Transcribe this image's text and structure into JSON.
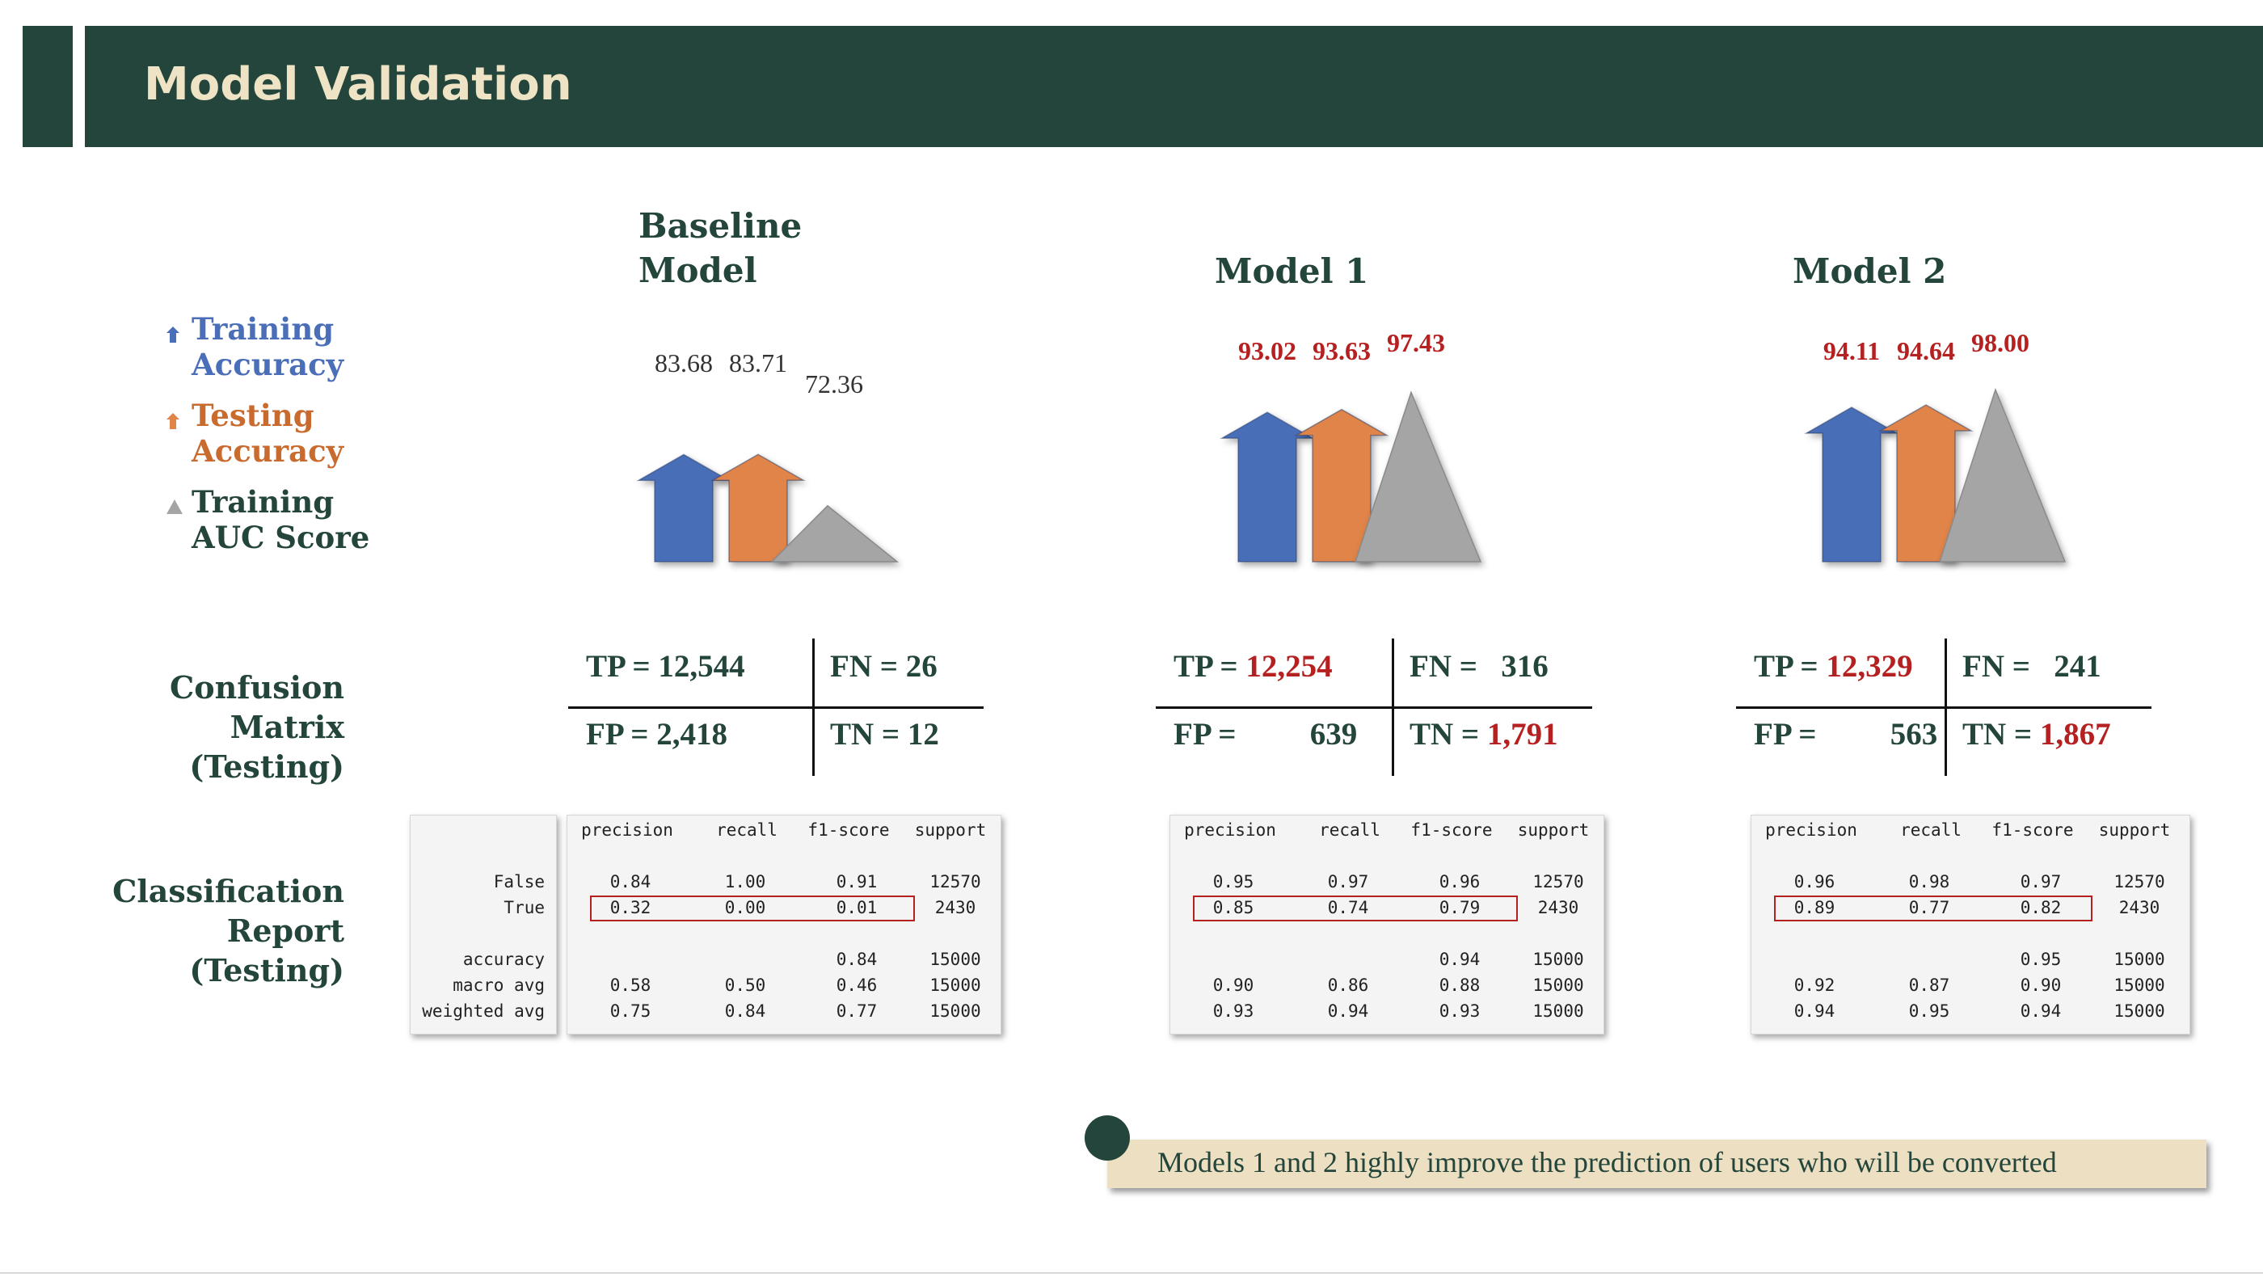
{
  "header": {
    "title": "Model Validation"
  },
  "legend": [
    {
      "icon": "blue-arrow-icon",
      "line1": "Training",
      "line2": "Accuracy",
      "color": "#4a6eb8"
    },
    {
      "icon": "orange-arrow-icon",
      "line1": "Testing",
      "line2": "Accuracy",
      "color": "#c96a2e"
    },
    {
      "icon": "gray-triangle-icon",
      "line1": "Training",
      "line2": "AUC Score",
      "color": "#23453b"
    }
  ],
  "row_labels": {
    "confusion": [
      "Confusion",
      "Matrix",
      "(Testing)"
    ],
    "classification": [
      "Classification",
      "Report",
      "(Testing)"
    ]
  },
  "colors": {
    "header_bg": "#23453b",
    "header_text": "#efe3c5",
    "training_accuracy": "#4a6eb8",
    "testing_accuracy": "#e08448",
    "auc": "#a5a5a5",
    "highlight_red": "#b52121",
    "callout_bg": "#ede0c2"
  },
  "report_headers": {
    "precision": "precision",
    "recall": "recall",
    "f1": "f1-score",
    "support": "support"
  },
  "report_row_labels": [
    "False",
    "True",
    "accuracy",
    "macro avg",
    "weighted avg"
  ],
  "models": [
    {
      "title_line1": "Baseline",
      "title_line2": "Model",
      "metrics": {
        "train_acc": "83.68",
        "test_acc": "83.71",
        "auc": "72.36"
      },
      "confusion": {
        "tp_label": "TP = ",
        "tp": "12,544",
        "fn_label": "FN = ",
        "fn": "26",
        "fp_label": "FP = ",
        "fp": "2,418",
        "tn_label": "TN = ",
        "tn": "12"
      },
      "report": {
        "false": [
          "0.84",
          "1.00",
          "0.91",
          "12570"
        ],
        "true": [
          "0.32",
          "0.00",
          "0.01",
          "2430"
        ],
        "accuracy": [
          "",
          "",
          "0.84",
          "15000"
        ],
        "macro": [
          "0.58",
          "0.50",
          "0.46",
          "15000"
        ],
        "weighted": [
          "0.75",
          "0.84",
          "0.77",
          "15000"
        ]
      }
    },
    {
      "title_line1": "Model 1",
      "title_line2": "",
      "metrics": {
        "train_acc": "93.02",
        "test_acc": "93.63",
        "auc": "97.43"
      },
      "confusion": {
        "tp_label": "TP = ",
        "tp": "12,254",
        "fn_label": "FN = ",
        "fn": "316",
        "fp_label": "FP = ",
        "fp": "639",
        "tn_label": "TN = ",
        "tn": "1,791"
      },
      "report": {
        "false": [
          "0.95",
          "0.97",
          "0.96",
          "12570"
        ],
        "true": [
          "0.85",
          "0.74",
          "0.79",
          "2430"
        ],
        "accuracy": [
          "",
          "",
          "0.94",
          "15000"
        ],
        "macro": [
          "0.90",
          "0.86",
          "0.88",
          "15000"
        ],
        "weighted": [
          "0.93",
          "0.94",
          "0.93",
          "15000"
        ]
      }
    },
    {
      "title_line1": "Model 2",
      "title_line2": "",
      "metrics": {
        "train_acc": "94.11",
        "test_acc": "94.64",
        "auc": "98.00"
      },
      "confusion": {
        "tp_label": "TP = ",
        "tp": "12,329",
        "fn_label": "FN = ",
        "fn": "241",
        "fp_label": "FP = ",
        "fp": "563",
        "tn_label": "TN = ",
        "tn": "1,867"
      },
      "report": {
        "false": [
          "0.96",
          "0.98",
          "0.97",
          "12570"
        ],
        "true": [
          "0.89",
          "0.77",
          "0.82",
          "2430"
        ],
        "accuracy": [
          "",
          "",
          "0.95",
          "15000"
        ],
        "macro": [
          "0.92",
          "0.87",
          "0.90",
          "15000"
        ],
        "weighted": [
          "0.94",
          "0.95",
          "0.94",
          "15000"
        ]
      }
    }
  ],
  "callout": {
    "text": "Models 1 and 2 highly improve the prediction of users who will be converted"
  }
}
